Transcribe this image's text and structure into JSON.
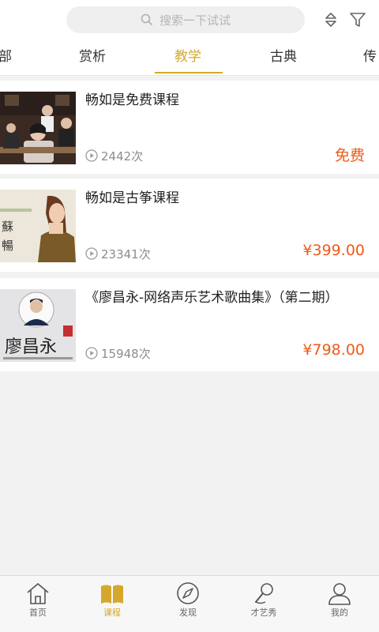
{
  "search": {
    "placeholder": "搜索一下试试"
  },
  "tabs": [
    {
      "label": "部"
    },
    {
      "label": "赏析"
    },
    {
      "label": "教学"
    },
    {
      "label": "古典"
    },
    {
      "label": "传"
    }
  ],
  "courses": [
    {
      "title": "畅如是免费课程",
      "views": "2442次",
      "price": "免费"
    },
    {
      "title": "畅如是古筝课程",
      "views": "23341次",
      "price": "¥399.00",
      "thumb_text": "蘇 暢"
    },
    {
      "title": "《廖昌永-网络声乐艺术歌曲集》（第二期）",
      "views": "15948次",
      "price": "¥798.00",
      "thumb_text": "廖昌永"
    }
  ],
  "nav": [
    {
      "label": "首页"
    },
    {
      "label": "课程"
    },
    {
      "label": "发现"
    },
    {
      "label": "才艺秀"
    },
    {
      "label": "我的"
    }
  ],
  "colors": {
    "accent": "#d4a82b",
    "price": "#ef5a1a"
  }
}
